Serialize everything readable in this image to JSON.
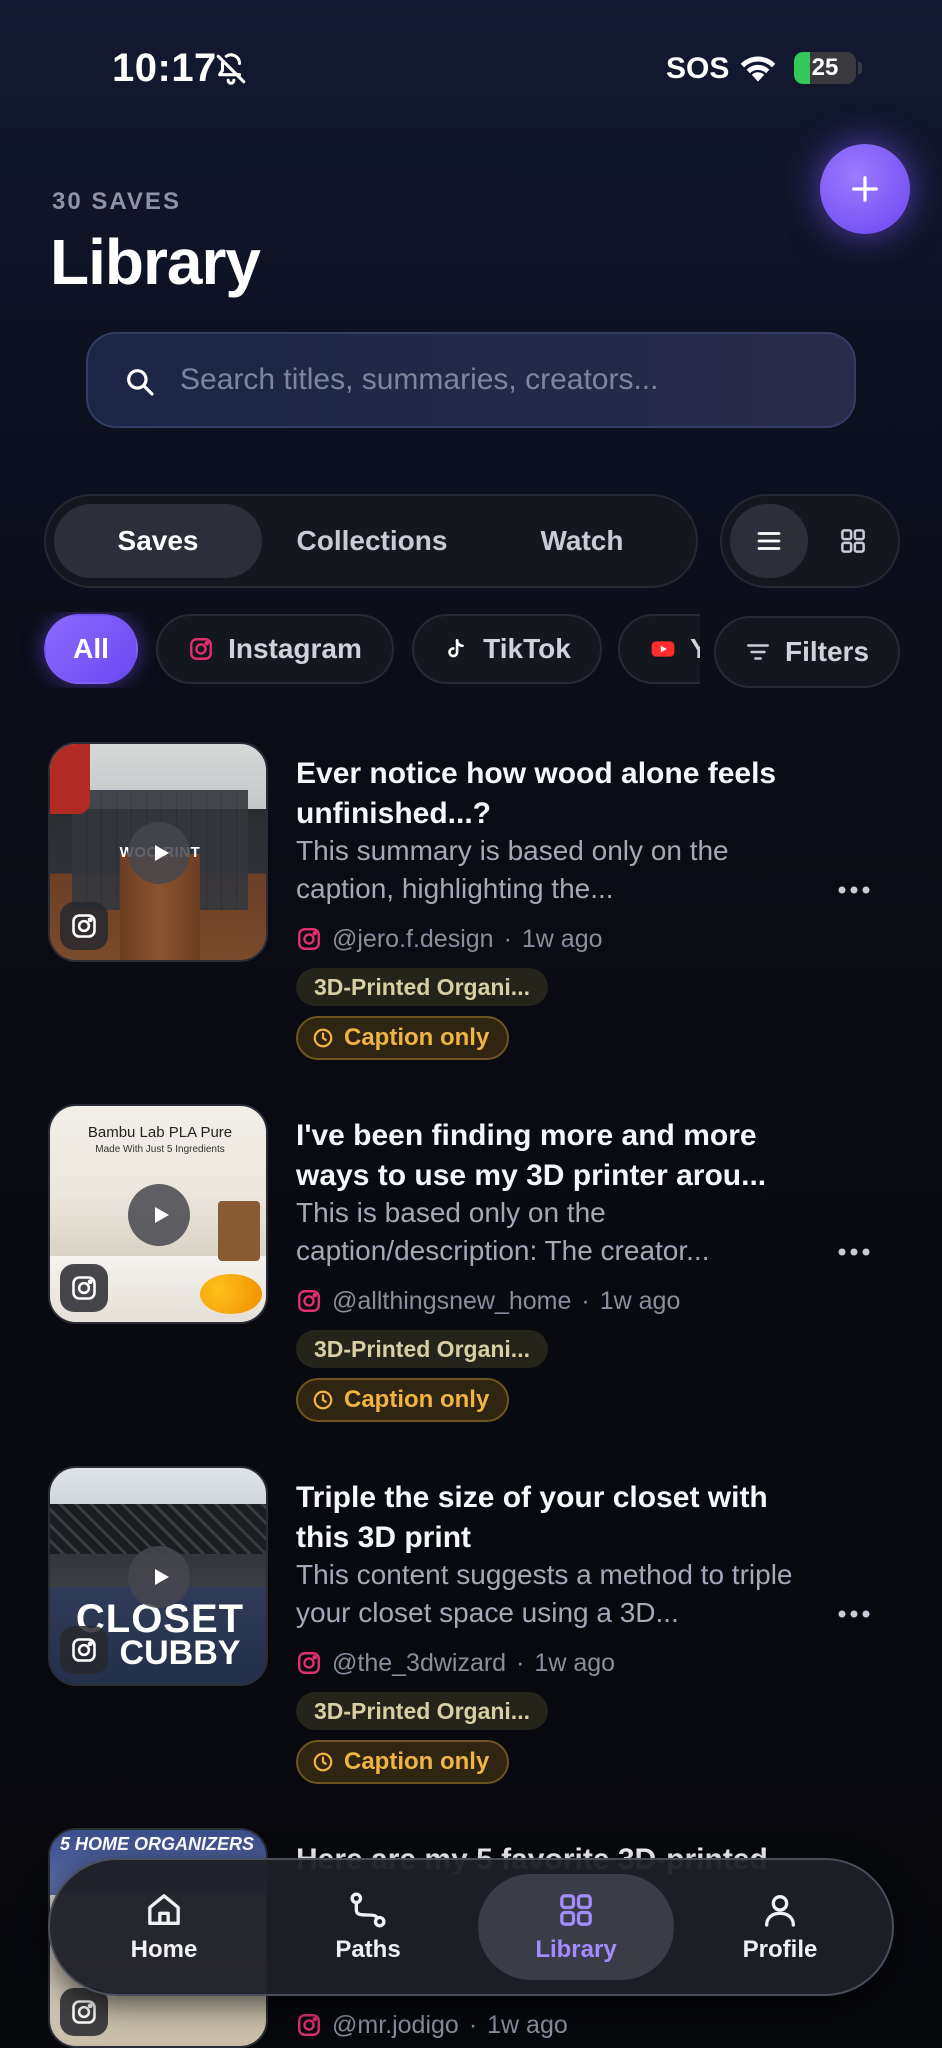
{
  "status_bar": {
    "time": "10:17",
    "sos": "SOS",
    "battery": "25",
    "battery_level": 0.25
  },
  "header": {
    "count": "30 SAVES",
    "title": "Library"
  },
  "search": {
    "placeholder": "Search titles, summaries, creators..."
  },
  "tabs": [
    "Saves",
    "Collections",
    "Watch"
  ],
  "active_tab": "Saves",
  "view_mode": "list",
  "chips": [
    {
      "label": "All",
      "icon": "none",
      "active": true
    },
    {
      "label": "Instagram",
      "icon": "instagram-icon",
      "active": false
    },
    {
      "label": "TikTok",
      "icon": "tiktok-icon",
      "active": false
    },
    {
      "label": "Y",
      "icon": "youtube-icon",
      "active": false
    }
  ],
  "filters_label": "Filters",
  "items": [
    {
      "title": "Ever notice how wood alone feels unfinished...?",
      "summary": "This summary is based only on the caption, highlighting the...",
      "creator": "@jero.f.design",
      "time": "1w ago",
      "collection": "3D-Printed Organi...",
      "badge": "Caption only",
      "thumb_text": "WOO     RINT"
    },
    {
      "title": "I've been finding more and more ways to use my 3D printer arou...",
      "summary": "This is based only on the caption/description: The creator...",
      "creator": "@allthingsnew_home",
      "time": "1w ago",
      "collection": "3D-Printed Organi...",
      "badge": "Caption only",
      "thumb_text": "Bambu Lab PLA Pure",
      "thumb_subtext": "Made With Just 5 Ingredients"
    },
    {
      "title": "Triple the size of your closet with this 3D print",
      "summary": "This content suggests a method to triple your closet space using a 3D...",
      "creator": "@the_3dwizard",
      "time": "1w ago",
      "collection": "3D-Printed Organi...",
      "badge": "Caption only",
      "thumb_text": "CLOSET",
      "thumb_subtext": "CUBBY"
    },
    {
      "title": "Here are my 5 favorite 3D-printed",
      "creator": "@mr.jodigo",
      "time": "1w ago",
      "thumb_text": "5 HOME ORGANIZERS"
    }
  ],
  "nav": [
    {
      "label": "Home",
      "icon": "home-icon"
    },
    {
      "label": "Paths",
      "icon": "paths-icon"
    },
    {
      "label": "Library",
      "icon": "grid-icon",
      "active": true
    },
    {
      "label": "Profile",
      "icon": "profile-icon"
    }
  ],
  "colors": {
    "accent": "#7c5cff",
    "badge_text": "#f0b444",
    "instagram": "#e1306c"
  }
}
